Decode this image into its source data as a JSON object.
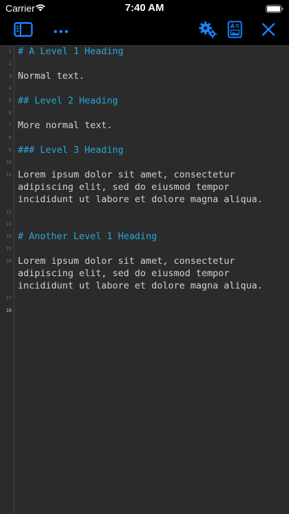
{
  "status": {
    "carrier": "Carrier",
    "time": "7:40 AM"
  },
  "toolbar": {
    "icons": {
      "sidebar": "sidebar-icon",
      "more": "ellipsis-icon",
      "settings": "gears-icon",
      "preview": "document-preview-icon",
      "close": "close-icon"
    },
    "accent": "#1a84ff"
  },
  "editor": {
    "line_numbers": [
      "1",
      "2",
      "3",
      "4",
      "5",
      "6",
      "7",
      "8",
      "9",
      "10",
      "11",
      "12",
      "13",
      "14",
      "15",
      "16",
      "17",
      "18"
    ],
    "lines": [
      "# A Level 1 Heading",
      "Normal text.",
      "## Level 2 Heading",
      "More normal text.",
      "### Level 3 Heading",
      "Lorem ipsum dolor sit amet, consectetur\nadipiscing elit, sed do eiusmod tempor\nincididunt ut labore et dolore magna aliqua.",
      "# Another Level 1 Heading",
      "Lorem ipsum dolor sit amet, consectetur\nadipiscing elit, sed do eiusmod tempor\nincididunt ut labore et dolore magna aliqua."
    ],
    "colors": {
      "heading": "#2aa7d8",
      "text": "#d2d2d2",
      "background": "#2b2b2b"
    }
  }
}
